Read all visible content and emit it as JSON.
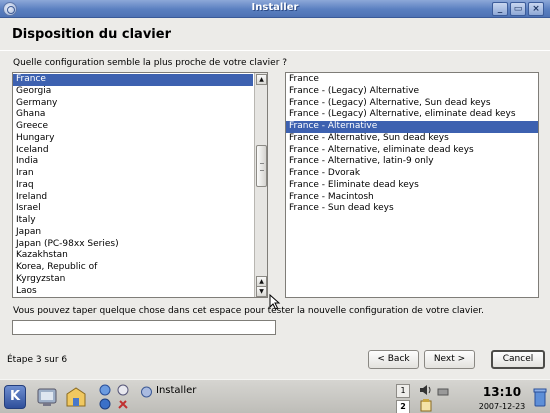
{
  "window": {
    "title": "Installer",
    "minimize_glyph": "_",
    "maximize_glyph": "▭",
    "close_glyph": "×"
  },
  "page": {
    "heading": "Disposition du clavier",
    "question": "Quelle configuration semble la plus proche de votre clavier ?",
    "hint": "Vous pouvez taper quelque chose dans cet espace pour tester la nouvelle configuration de votre clavier.",
    "test_input": {
      "value": "",
      "placeholder": ""
    },
    "step": "Étape 3 sur 6"
  },
  "countries": {
    "selected": "France",
    "items": [
      "France",
      "Georgia",
      "Germany",
      "Ghana",
      "Greece",
      "Hungary",
      "Iceland",
      "India",
      "Iran",
      "Iraq",
      "Ireland",
      "Israel",
      "Italy",
      "Japan",
      "Japan (PC-98xx Series)",
      "Kazakhstan",
      "Korea, Republic of",
      "Kyrgyzstan",
      "Laos"
    ]
  },
  "variants": {
    "selected": "France - Alternative",
    "items": [
      "France",
      "France - (Legacy) Alternative",
      "France - (Legacy) Alternative, Sun dead keys",
      "France - (Legacy) Alternative, eliminate dead keys",
      "France - Alternative",
      "France - Alternative, Sun dead keys",
      "France - Alternative, eliminate dead keys",
      "France - Alternative, latin-9 only",
      "France - Dvorak",
      "France - Eliminate dead keys",
      "France - Macintosh",
      "France - Sun dead keys"
    ]
  },
  "buttons": {
    "back": "< Back",
    "next": "Next >",
    "cancel": "Cancel"
  },
  "scroll_arrows": {
    "up": "▲",
    "down": "▼"
  },
  "taskbar": {
    "kmenu_glyph": "K",
    "task_label": "Installer",
    "desktops": [
      "1",
      "2"
    ],
    "clock": "13:10",
    "date": "2007-12-23"
  },
  "colors": {
    "selection": "#3d61b0",
    "titlebar": "#5a7fc0",
    "window_bg": "#ecebe8"
  }
}
